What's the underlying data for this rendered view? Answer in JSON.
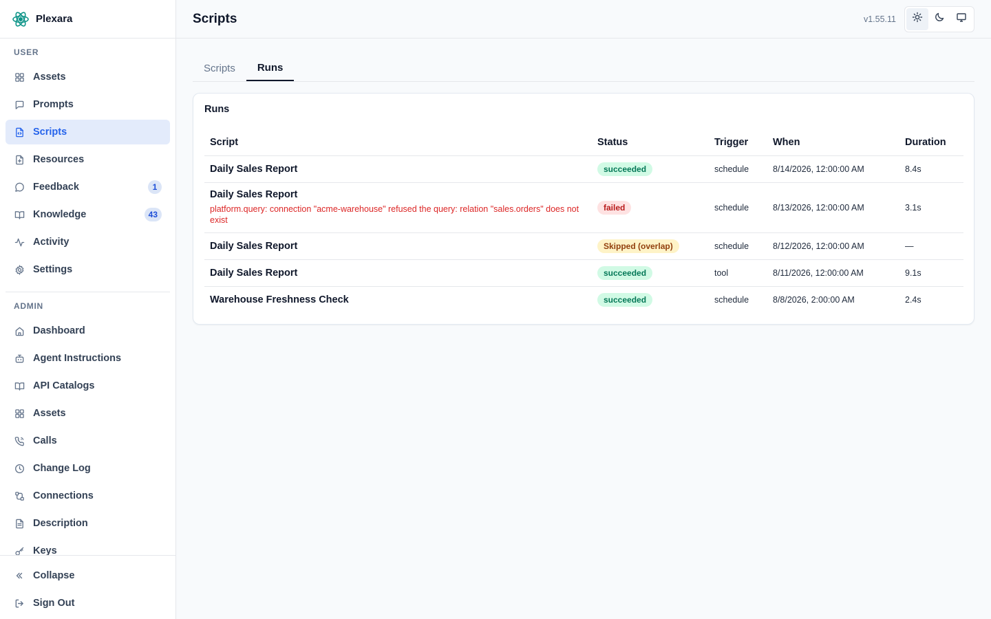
{
  "brand": {
    "name": "Plexara"
  },
  "sidebar": {
    "user_label": "USER",
    "user_items": [
      {
        "label": "Assets",
        "icon": "grid-icon"
      },
      {
        "label": "Prompts",
        "icon": "message-square-icon"
      },
      {
        "label": "Scripts",
        "icon": "file-code-icon",
        "active": true
      },
      {
        "label": "Resources",
        "icon": "file-plus-icon"
      },
      {
        "label": "Feedback",
        "icon": "message-circle-icon",
        "badge": "1"
      },
      {
        "label": "Knowledge",
        "icon": "book-open-icon",
        "badge": "43"
      },
      {
        "label": "Activity",
        "icon": "activity-icon"
      },
      {
        "label": "Settings",
        "icon": "gear-icon"
      }
    ],
    "admin_label": "ADMIN",
    "admin_items": [
      {
        "label": "Dashboard",
        "icon": "home-icon"
      },
      {
        "label": "Agent Instructions",
        "icon": "bot-icon"
      },
      {
        "label": "API Catalogs",
        "icon": "book-open-icon"
      },
      {
        "label": "Assets",
        "icon": "grid-icon"
      },
      {
        "label": "Calls",
        "icon": "phone-icon"
      },
      {
        "label": "Change Log",
        "icon": "clock-icon"
      },
      {
        "label": "Connections",
        "icon": "cable-icon"
      },
      {
        "label": "Description",
        "icon": "file-text-icon"
      },
      {
        "label": "Keys",
        "icon": "key-icon"
      }
    ],
    "footer": {
      "collapse_label": "Collapse",
      "signout_label": "Sign Out"
    }
  },
  "header": {
    "title": "Scripts",
    "version": "v1.55.11"
  },
  "tabs": [
    {
      "label": "Scripts",
      "active": false
    },
    {
      "label": "Runs",
      "active": true
    }
  ],
  "runs_card": {
    "title": "Runs",
    "columns": [
      "Script",
      "Status",
      "Trigger",
      "When",
      "Duration"
    ],
    "rows": [
      {
        "script": "Daily Sales Report",
        "error": "",
        "status": "succeeded",
        "status_kind": "succeeded",
        "trigger": "schedule",
        "when": "8/14/2026, 12:00:00 AM",
        "duration": "8.4s"
      },
      {
        "script": "Daily Sales Report",
        "error": "platform.query: connection \"acme-warehouse\" refused the query: relation \"sales.orders\" does not exist",
        "status": "failed",
        "status_kind": "failed",
        "trigger": "schedule",
        "when": "8/13/2026, 12:00:00 AM",
        "duration": "3.1s"
      },
      {
        "script": "Daily Sales Report",
        "error": "",
        "status": "Skipped (overlap)",
        "status_kind": "skipped",
        "trigger": "schedule",
        "when": "8/12/2026, 12:00:00 AM",
        "duration": "—"
      },
      {
        "script": "Daily Sales Report",
        "error": "",
        "status": "succeeded",
        "status_kind": "succeeded",
        "trigger": "tool",
        "when": "8/11/2026, 12:00:00 AM",
        "duration": "9.1s"
      },
      {
        "script": "Warehouse Freshness Check",
        "error": "",
        "status": "succeeded",
        "status_kind": "succeeded",
        "trigger": "schedule",
        "when": "8/8/2026, 2:00:00 AM",
        "duration": "2.4s"
      }
    ]
  },
  "colors": {
    "accent": "#2563eb",
    "active_bg": "#e3ebfb",
    "success": "#047857",
    "danger": "#dc2626",
    "warning": "#92400e"
  }
}
